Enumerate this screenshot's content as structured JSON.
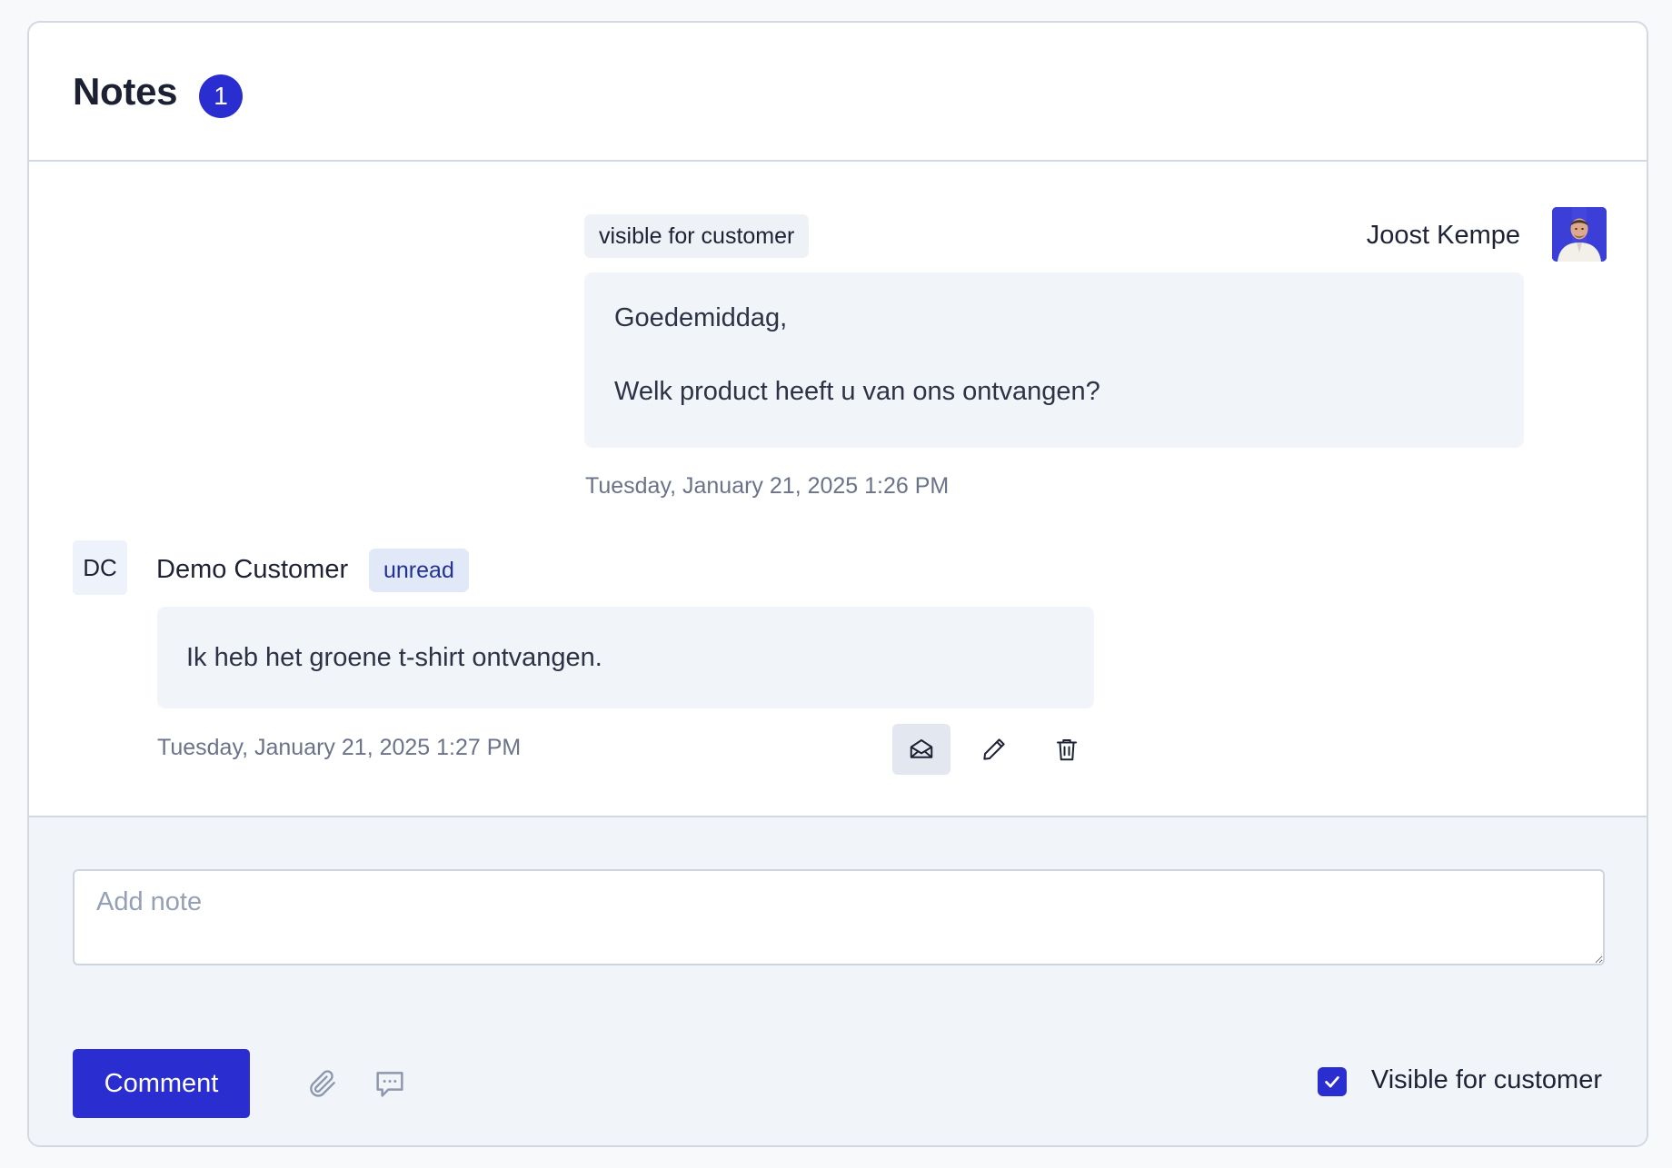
{
  "notes_panel": {
    "title": "Notes",
    "count": "1"
  },
  "notes": [
    {
      "author": "Joost Kempe",
      "visibility_tag": "visible for customer",
      "avatar_icon": "user-photo",
      "lines": [
        "Goedemiddag,",
        "Welk product heeft u van ons ontvangen?"
      ],
      "timestamp": "Tuesday, January 21, 2025 1:26 PM"
    },
    {
      "author": "Demo Customer",
      "initials": "DC",
      "status_tag": "unread",
      "text": "Ik heb het groene t-shirt ontvangen.",
      "timestamp": "Tuesday, January 21, 2025 1:27 PM",
      "actions": [
        {
          "icon": "envelope-open-icon",
          "active": true
        },
        {
          "icon": "pencil-icon",
          "active": false
        },
        {
          "icon": "trash-icon",
          "active": false
        }
      ]
    }
  ],
  "composer": {
    "placeholder": "Add note",
    "value": "",
    "submit_label": "Comment",
    "attach_icon": "paperclip-icon",
    "canned_icon": "chat-bubble-icon",
    "visible_checkbox": {
      "label": "Visible for customer",
      "checked": true
    }
  },
  "colors": {
    "accent": "#2a2dd0",
    "border": "#d3d8e2",
    "bubble": "#f1f4f9",
    "muted_text": "#6b7389"
  }
}
